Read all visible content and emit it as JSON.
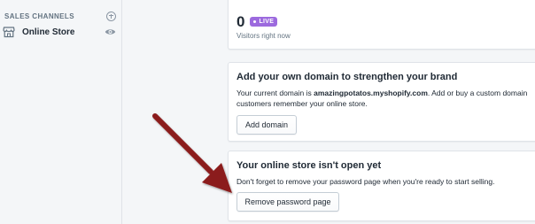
{
  "sidebar": {
    "sales_channels_title": "SALES CHANNELS",
    "add_icon": "plus-circle-icon",
    "channels": [
      {
        "label": "Online Store",
        "icon": "store-icon",
        "action_icon": "eye-icon"
      }
    ]
  },
  "live_view": {
    "visitor_count": "0",
    "badge": "LIVE",
    "caption": "Visitors right now"
  },
  "domain_card": {
    "title": "Add your own domain to strengthen your brand",
    "text_prefix": "Your current domain is ",
    "domain": "amazingpotatos.myshopify.com",
    "text_suffix": ". Add or buy a custom domain",
    "text_line2": "customers remember your online store.",
    "button_label": "Add domain"
  },
  "open_card": {
    "title": "Your online store isn't open yet",
    "text": "Don't forget to remove your password page when you're ready to start selling.",
    "button_label": "Remove password page"
  },
  "colors": {
    "live_badge": "#9c6ade",
    "annotation_arrow": "#8b1a1a",
    "background": "#f4f6f8"
  }
}
